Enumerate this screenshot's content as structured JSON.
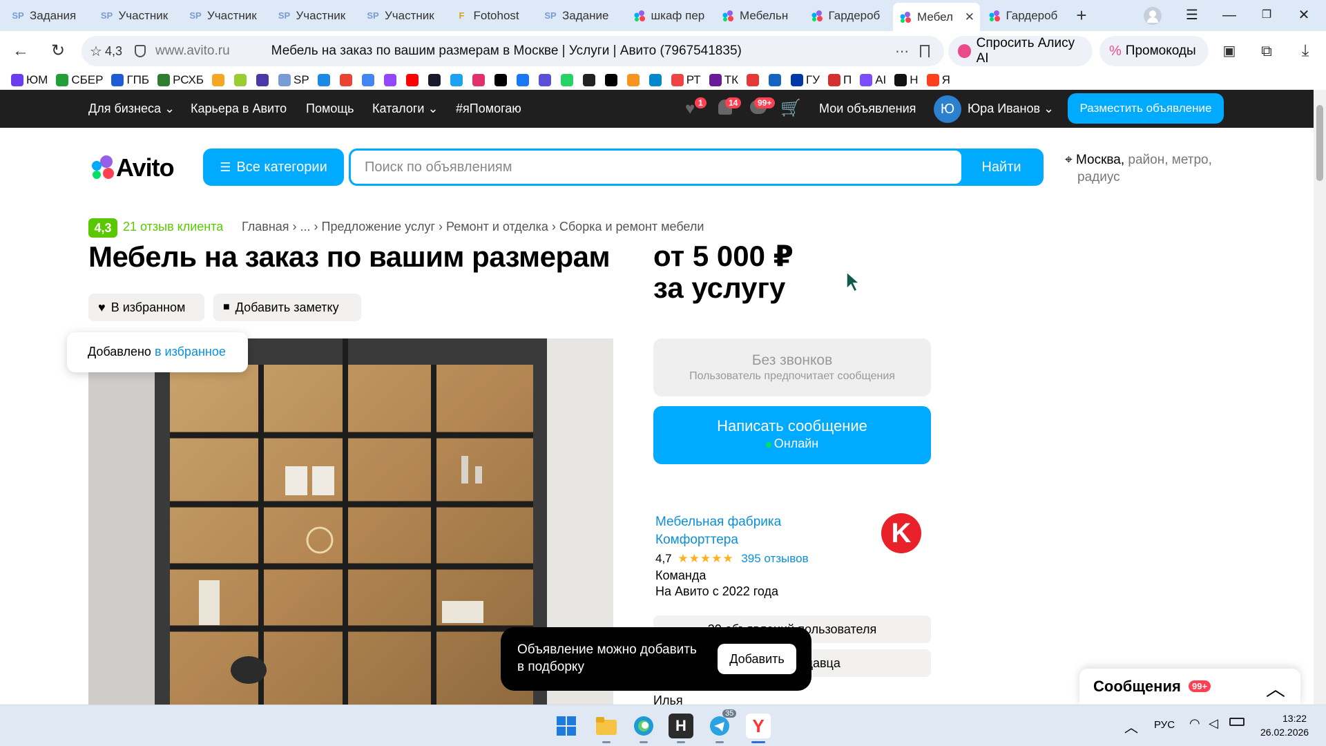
{
  "browser": {
    "tabs": [
      {
        "label": "Задания",
        "icon": "SP"
      },
      {
        "label": "Участник",
        "icon": "SP"
      },
      {
        "label": "Участник",
        "icon": "SP"
      },
      {
        "label": "Участник",
        "icon": "SP"
      },
      {
        "label": "Участник",
        "icon": "SP"
      },
      {
        "label": "Fotohost",
        "icon": "F"
      },
      {
        "label": "Задание",
        "icon": "SP"
      },
      {
        "label": "шкаф пер",
        "icon": "avito"
      },
      {
        "label": "Мебельн",
        "icon": "avito"
      },
      {
        "label": "Гардероб",
        "icon": "avito"
      },
      {
        "label": "Мебел",
        "icon": "avito",
        "active": true
      },
      {
        "label": "Гардероб",
        "icon": "avito"
      }
    ],
    "rating": "4,3",
    "domain": "www.avito.ru",
    "page_title": "Мебель на заказ по вашим размерам в Москве | Услуги | Авито (7967541835)",
    "alice_label": "Спросить Алису AI",
    "promo_label": "Промокоды",
    "bookmarks": [
      "ЮМ",
      "СБЕР",
      "ГПБ",
      "РСХБ",
      "",
      "",
      "",
      "SP",
      "",
      "",
      "",
      "",
      "",
      "",
      "",
      "",
      "",
      "",
      "",
      "",
      "",
      "",
      "",
      "",
      "РТ",
      "ТК",
      "",
      "",
      "ГУ",
      "П",
      "AI",
      "Н",
      "Я"
    ]
  },
  "header": {
    "links": [
      "Для бизнеса",
      "Карьера в Авито",
      "Помощь",
      "Каталоги",
      "#яПомогаю"
    ],
    "fav_count": "1",
    "notif_count": "14",
    "msg_count": "99+",
    "my_ads": "Мои объявления",
    "user_initial": "Ю",
    "user_name": "Юра Иванов",
    "post_button": "Разместить объявление"
  },
  "search": {
    "logo": "Avito",
    "categories_button": "Все категории",
    "placeholder": "Поиск по объявлениям",
    "find_button": "Найти",
    "location_city": "Москва",
    "location_rest": "район, метро,",
    "location_rest2": "радиус"
  },
  "listing": {
    "rating_badge": "4,3",
    "reviews_link": "21 отзыв клиента",
    "breadcrumbs": [
      "Главная",
      "...",
      "Предложение услуг",
      "Ремонт и отделка",
      "Сборка и ремонт мебели"
    ],
    "title": "Мебель на заказ по вашим размерам",
    "price_line1": "от 5 000 ₽",
    "price_line2": "за услугу",
    "favorite_button": "В избранном",
    "note_button": "Добавить заметку",
    "added_toast_text": "Добавлено",
    "added_toast_link": "в избранное",
    "no_calls_title": "Без звонков",
    "no_calls_sub": "Пользователь предпочитает сообщения",
    "write_button": "Написать сообщение",
    "online_status": "Онлайн"
  },
  "seller": {
    "name_line1": "Мебельная фабрика",
    "name_line2": "Комфорттера",
    "rating": "4,7",
    "stars": 4.7,
    "reviews": "395 отзывов",
    "type": "Команда",
    "since": "На Авито с 2022 года",
    "button1": "30 объявлений пользователя",
    "button2": "продавца",
    "contact_name": "Илья"
  },
  "collection_toast": {
    "text_line1": "Объявление можно добавить",
    "text_line2": "в подборку",
    "button": "Добавить"
  },
  "messages_bar": {
    "label": "Сообщения",
    "count": "99+"
  },
  "taskbar": {
    "lang": "РУС",
    "time": "13:22",
    "date": "26.02.2026",
    "telegram_badge": "35"
  },
  "colors": {
    "avito_blue": "#00aaff",
    "rating_green": "#59c800",
    "badge_red": "#ff4053",
    "link_blue": "#0a8fd8"
  }
}
